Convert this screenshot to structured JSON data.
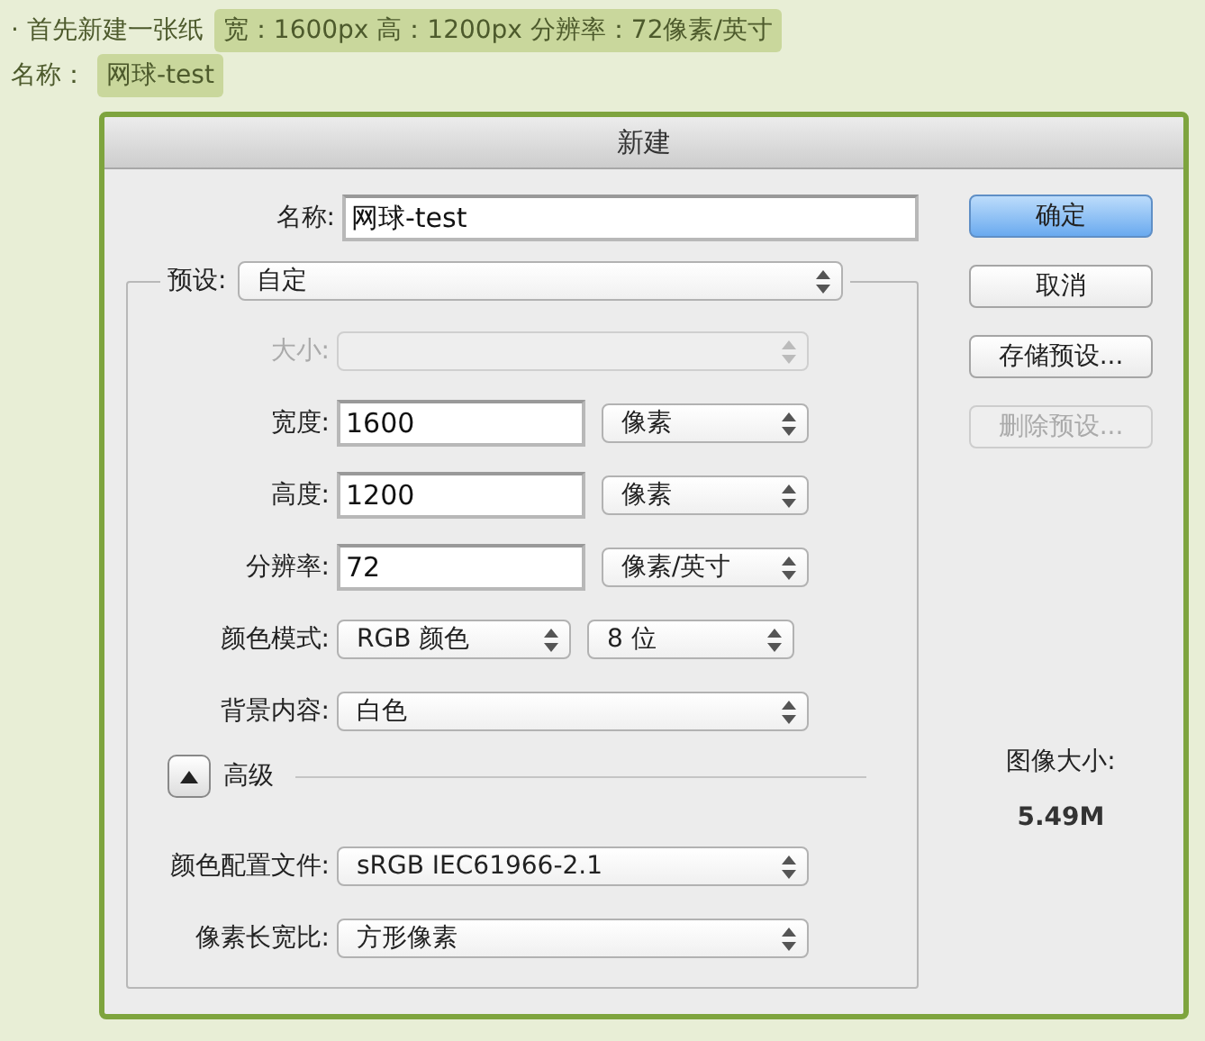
{
  "intro": {
    "lines": [
      {
        "text": "· 首先新建一张纸",
        "highlight": "宽：1600px 高：1200px 分辨率：72像素/英寸"
      },
      {
        "text": "名称：",
        "highlight": "网球-test"
      }
    ]
  },
  "dialog": {
    "title": "新建",
    "name": {
      "label": "名称:",
      "value": "网球-test"
    },
    "preset": {
      "label": "预设:",
      "value": "自定"
    },
    "rows": [
      {
        "kind": "select",
        "label": "大小:",
        "disabled": true
      },
      {
        "kind": "input",
        "label": "宽度:",
        "value": "1600",
        "unit": "像素"
      },
      {
        "kind": "input",
        "label": "高度:",
        "value": "1200",
        "unit": "像素"
      },
      {
        "kind": "input",
        "label": "分辨率:",
        "value": "72",
        "unit": "像素/英寸"
      },
      {
        "kind": "pair",
        "label": "颜色模式:",
        "value": "RGB 颜色",
        "unit": "8 位"
      },
      {
        "kind": "select",
        "label": "背景内容:",
        "value": "白色",
        "disabled": false
      }
    ],
    "advanced": {
      "label": "高级",
      "expanded": true,
      "rows": [
        {
          "kind": "select",
          "label": "颜色配置文件:",
          "value": "sRGB IEC61966-2.1",
          "disabled": false
        },
        {
          "kind": "select",
          "label": "像素长宽比:",
          "value": "方形像素",
          "disabled": false
        }
      ]
    },
    "buttons": [
      {
        "label": "确定",
        "default": true,
        "disabled": false
      },
      {
        "label": "取消",
        "default": false,
        "disabled": false
      },
      {
        "label": "存储预设...",
        "default": false,
        "disabled": false
      },
      {
        "label": "删除预设...",
        "default": false,
        "disabled": true
      }
    ],
    "image_size": {
      "label": "图像大小:",
      "value": "5.49M"
    }
  }
}
